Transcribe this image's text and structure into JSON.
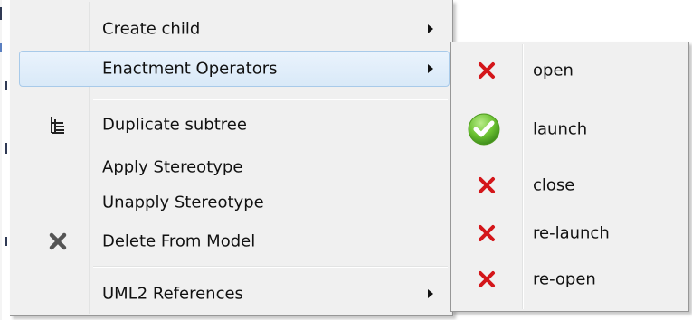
{
  "menu": {
    "items": [
      {
        "label": "Create child",
        "has_submenu": true
      },
      {
        "label": "Enactment Operators",
        "has_submenu": true,
        "highlighted": true
      },
      {
        "label": "Duplicate subtree",
        "icon": "tree-hierarchy-icon"
      },
      {
        "label": "Apply Stereotype"
      },
      {
        "label": "Unapply Stereotype"
      },
      {
        "label": "Delete From Model",
        "icon": "delete-x-icon"
      },
      {
        "label": "UML2 References",
        "has_submenu": true
      }
    ]
  },
  "submenu": {
    "items": [
      {
        "label": "open",
        "icon": "red-x-icon"
      },
      {
        "label": "launch",
        "icon": "green-check-icon"
      },
      {
        "label": "close",
        "icon": "red-x-icon"
      },
      {
        "label": "re-launch",
        "icon": "red-x-icon"
      },
      {
        "label": "re-open",
        "icon": "red-x-icon"
      }
    ]
  },
  "colors": {
    "menu_bg": "#f0f0f0",
    "highlight_border": "#a8cae9",
    "red_x": "#d4161a",
    "green_check": "#68b82c"
  }
}
